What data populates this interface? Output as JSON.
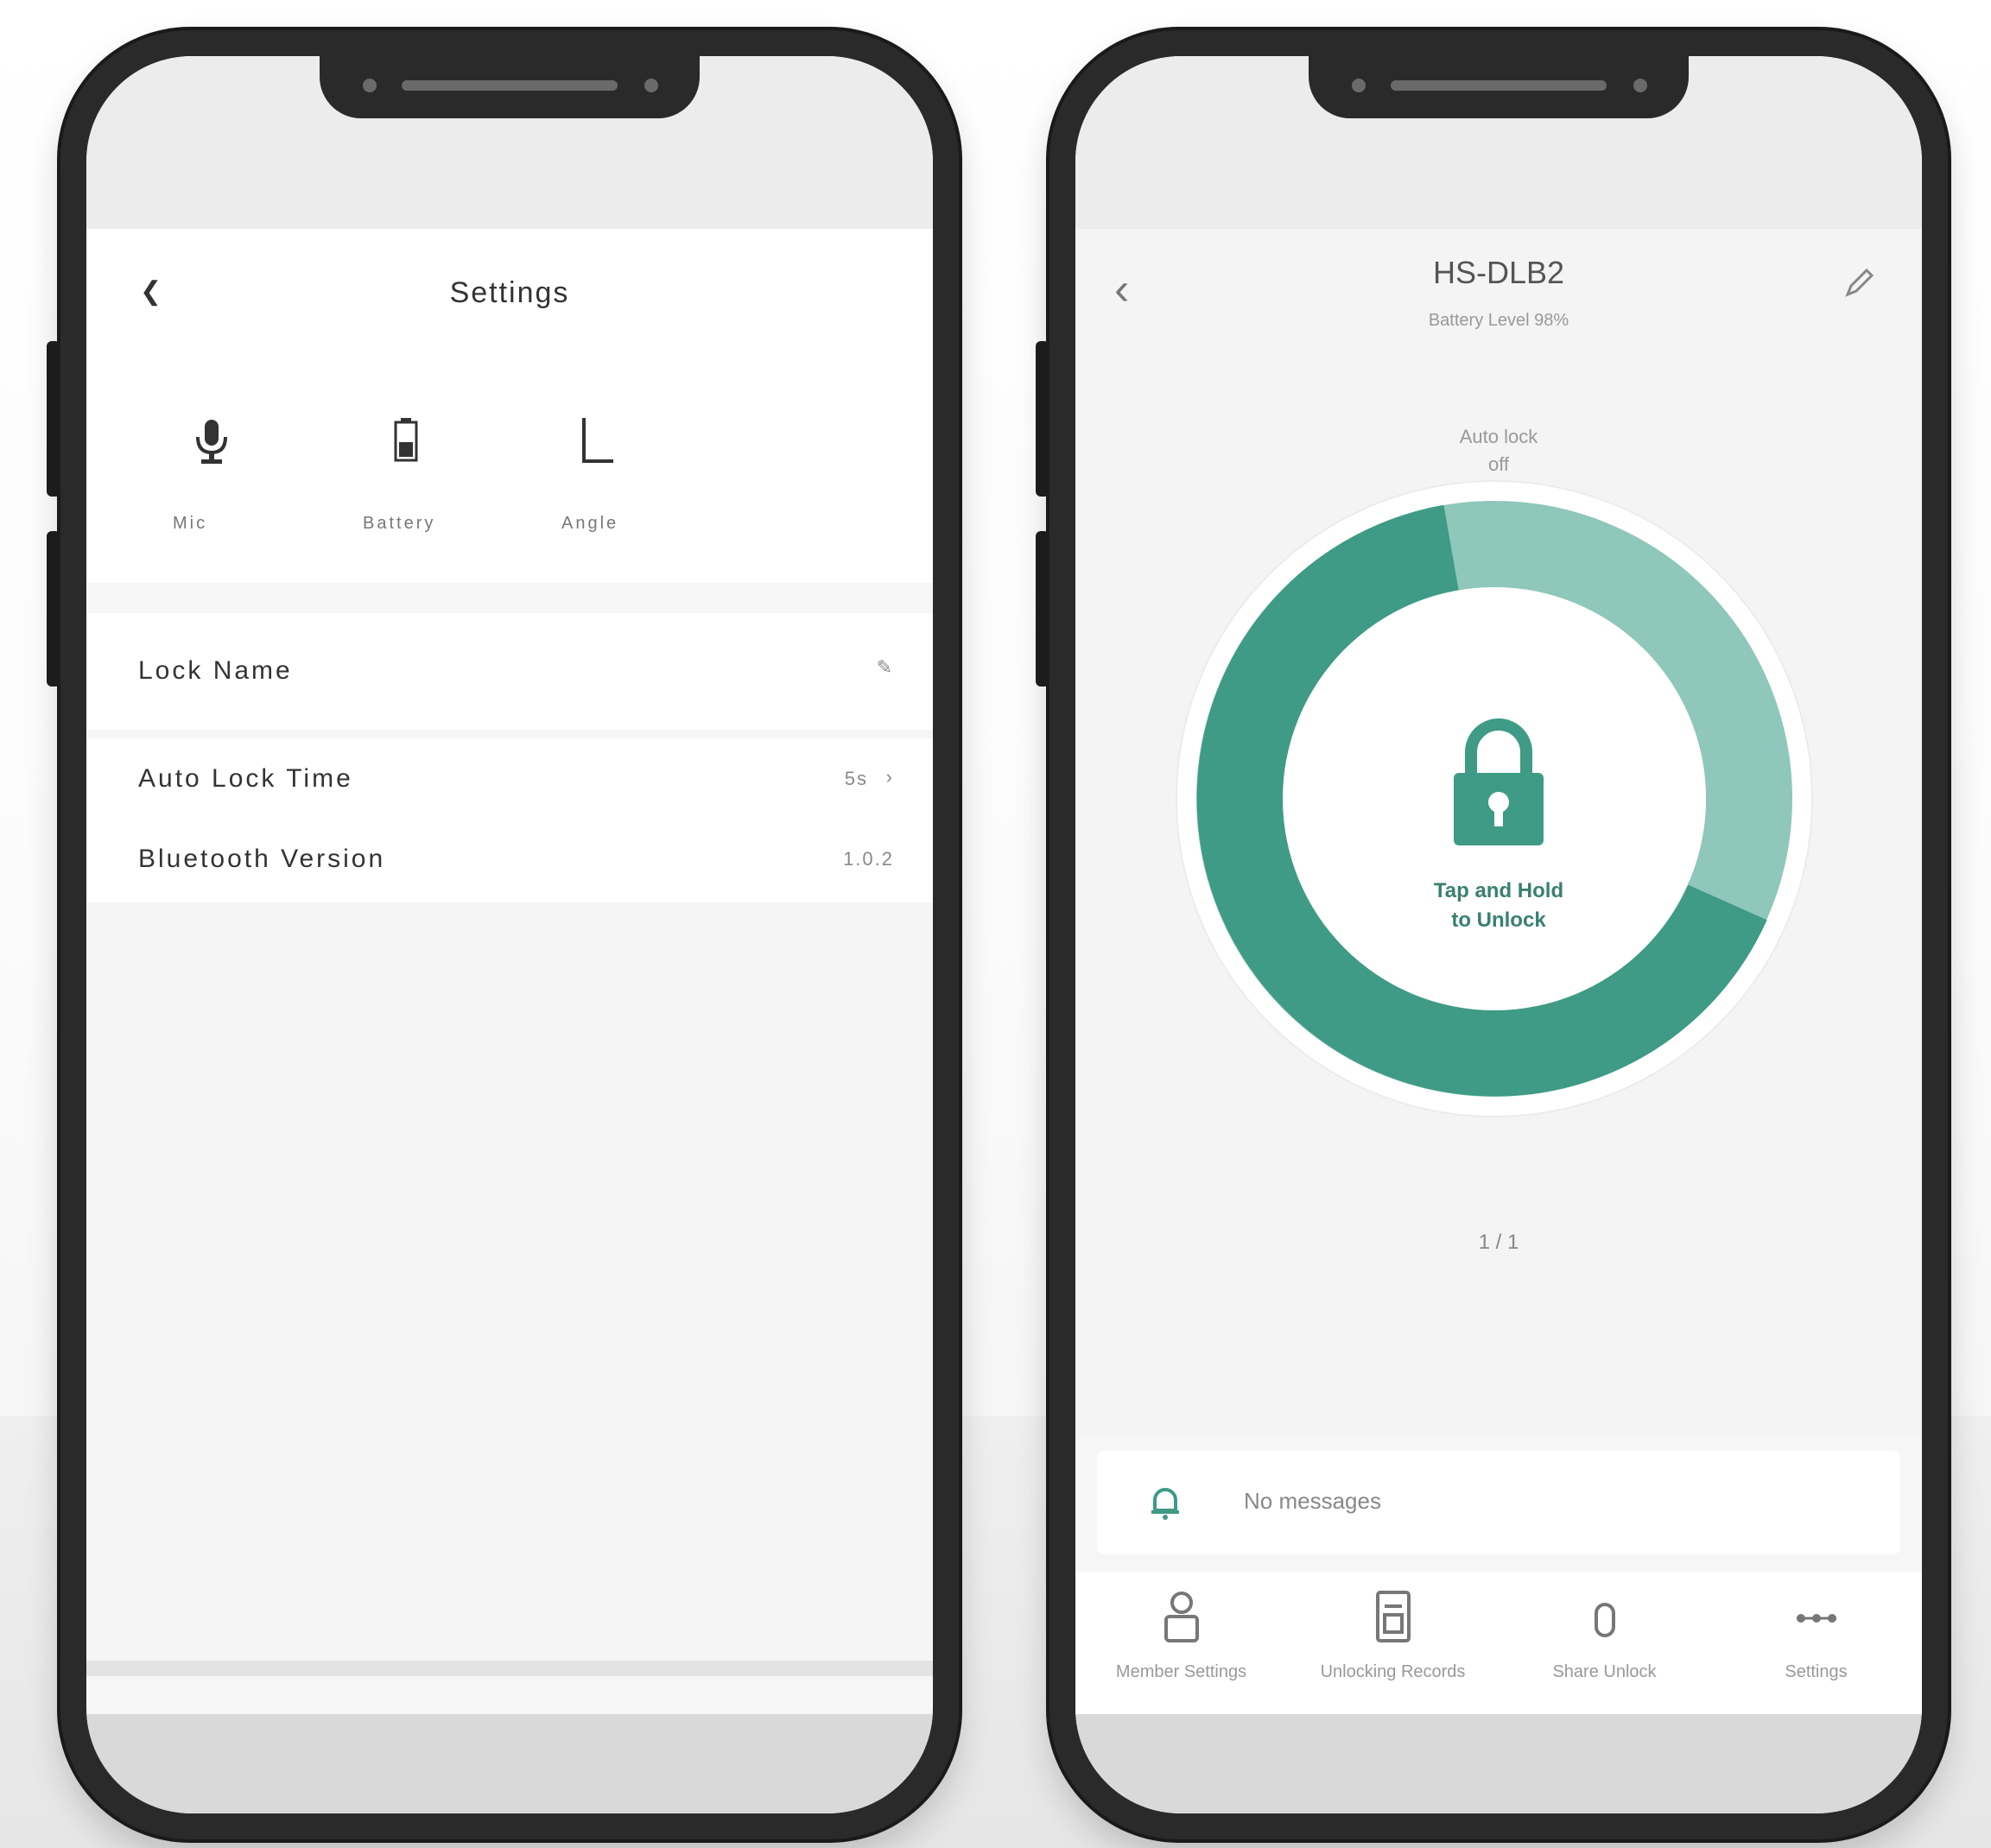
{
  "theme": {
    "accent": "#3f9a86",
    "accent_light": "#8fc7ba",
    "frame": "#2a2a2a"
  },
  "settings_screen": {
    "back_icon": "back-arrow-icon",
    "title": "Settings",
    "icons": [
      {
        "name": "microphone-icon",
        "label": "Mic"
      },
      {
        "name": "battery-icon",
        "label": "Battery"
      },
      {
        "name": "bracket-icon",
        "label": "Angle"
      }
    ],
    "rows": [
      {
        "label": "Lock Name",
        "value": ""
      },
      {
        "label": "Auto Lock Time",
        "value": "5s"
      },
      {
        "label": "Bluetooth Version",
        "value": "1.0.2"
      }
    ]
  },
  "lock_screen": {
    "back_icon": "back-arrow-icon",
    "title": "HS-DLB2",
    "subtitle": "Battery Level 98%",
    "edit_icon": "pencil-icon",
    "status_line1": "Auto lock",
    "status_line2": "off",
    "dial_text_line1": "Tap and Hold",
    "dial_text_line2": "to Unlock",
    "pager": "1 / 1",
    "messages": {
      "icon": "bell-icon",
      "text": "No messages"
    },
    "nav": [
      {
        "icon": "user-icon",
        "label": "Member Settings"
      },
      {
        "icon": "record-icon",
        "label": "Unlocking Records"
      },
      {
        "icon": "share-icon",
        "label": "Share Unlock"
      },
      {
        "icon": "more-icon",
        "label": "Settings"
      }
    ]
  }
}
